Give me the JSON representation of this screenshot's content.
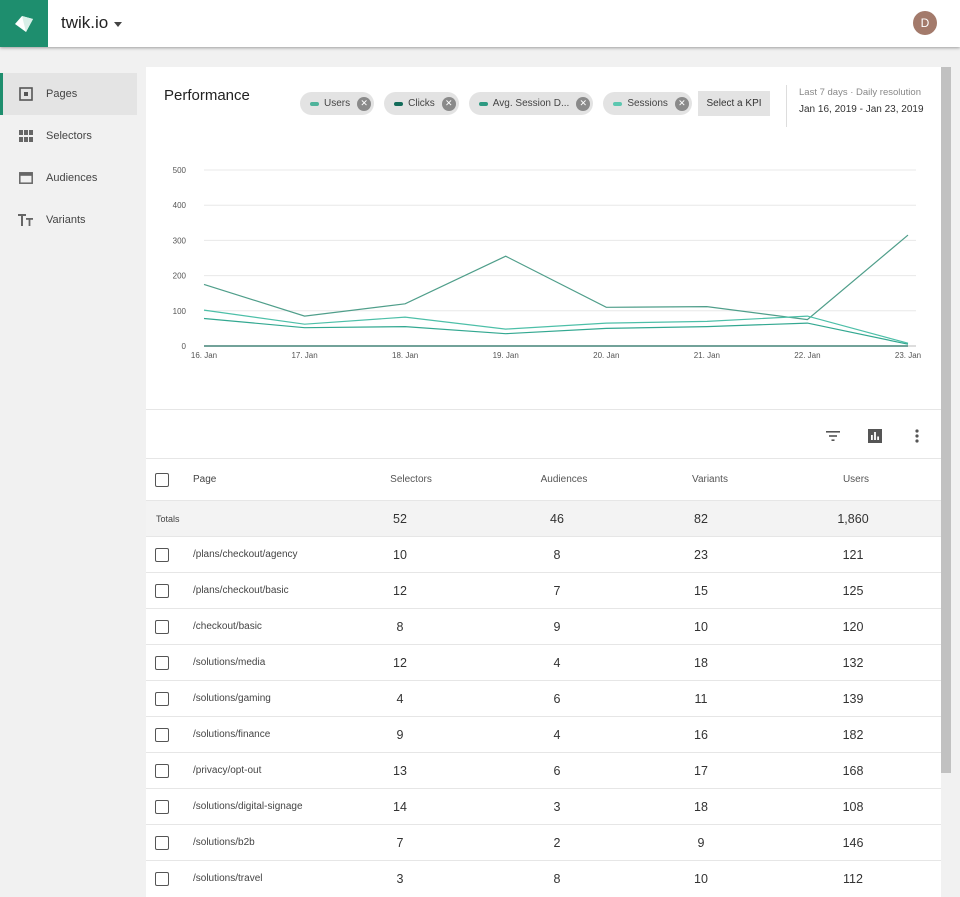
{
  "app": {
    "title": "twik.io",
    "avatar_initial": "D",
    "brand_color": "#1e8e6e"
  },
  "sidebar": {
    "items": [
      {
        "label": "Pages",
        "icon": "pages-icon",
        "active": true
      },
      {
        "label": "Selectors",
        "icon": "grid-icon",
        "active": false
      },
      {
        "label": "Audiences",
        "icon": "audience-card-icon",
        "active": false
      },
      {
        "label": "Variants",
        "icon": "text-size-icon",
        "active": false
      }
    ]
  },
  "performance": {
    "title": "Performance",
    "chips": [
      {
        "label": "Users",
        "color": "#4fb39b"
      },
      {
        "label": "Clicks",
        "color": "#136c5a"
      },
      {
        "label": "Avg. Session D...",
        "color": "#2e9a82"
      },
      {
        "label": "Sessions",
        "color": "#5cc7b0"
      }
    ],
    "kpi_button": "Select a KPI",
    "date_meta": "Last 7 days · Daily resolution",
    "date_range": "Jan 16, 2019 - Jan 23, 2019"
  },
  "chart_data": {
    "type": "line",
    "x": [
      "16. Jan",
      "17. Jan",
      "18. Jan",
      "19. Jan",
      "20. Jan",
      "21. Jan",
      "22. Jan",
      "23. Jan"
    ],
    "ylim": [
      0,
      500
    ],
    "yticks": [
      0,
      100,
      200,
      300,
      400,
      500
    ],
    "grid": true,
    "series": [
      {
        "name": "Users",
        "color": "#4f9e8a",
        "values": [
          175,
          85,
          120,
          255,
          110,
          112,
          75,
          315
        ]
      },
      {
        "name": "Clicks",
        "color": "#1d6b5c",
        "values": [
          0,
          0,
          0,
          0,
          0,
          0,
          0,
          0
        ]
      },
      {
        "name": "Avg. Session D...",
        "color": "#4dbfa8",
        "values": [
          102,
          62,
          82,
          48,
          65,
          70,
          85,
          8
        ]
      },
      {
        "name": "Sessions",
        "color": "#33a891",
        "values": [
          78,
          52,
          55,
          35,
          50,
          55,
          65,
          5
        ]
      }
    ]
  },
  "table": {
    "headers": {
      "page": "Page",
      "selectors": "Selectors",
      "audiences": "Audiences",
      "variants": "Variants",
      "users": "Users"
    },
    "totals": {
      "label": "Totals",
      "selectors": "52",
      "audiences": "46",
      "variants": "82",
      "users": "1,860"
    },
    "rows": [
      {
        "page": "/plans/checkout/agency",
        "selectors": "10",
        "audiences": "8",
        "variants": "23",
        "users": "121"
      },
      {
        "page": "/plans/checkout/basic",
        "selectors": "12",
        "audiences": "7",
        "variants": "15",
        "users": "125"
      },
      {
        "page": "/checkout/basic",
        "selectors": "8",
        "audiences": "9",
        "variants": "10",
        "users": "120"
      },
      {
        "page": "/solutions/media",
        "selectors": "12",
        "audiences": "4",
        "variants": "18",
        "users": "132"
      },
      {
        "page": "/solutions/gaming",
        "selectors": "4",
        "audiences": "6",
        "variants": "11",
        "users": "139"
      },
      {
        "page": "/solutions/finance",
        "selectors": "9",
        "audiences": "4",
        "variants": "16",
        "users": "182"
      },
      {
        "page": "/privacy/opt-out",
        "selectors": "13",
        "audiences": "6",
        "variants": "17",
        "users": "168"
      },
      {
        "page": "/solutions/digital-signage",
        "selectors": "14",
        "audiences": "3",
        "variants": "18",
        "users": "108"
      },
      {
        "page": "/solutions/b2b",
        "selectors": "7",
        "audiences": "2",
        "variants": "9",
        "users": "146"
      },
      {
        "page": "/solutions/travel",
        "selectors": "3",
        "audiences": "8",
        "variants": "10",
        "users": "112"
      }
    ]
  },
  "toolbar": {
    "icons": [
      "filter-icon",
      "chart-toggle-icon",
      "more-vert-icon"
    ]
  }
}
